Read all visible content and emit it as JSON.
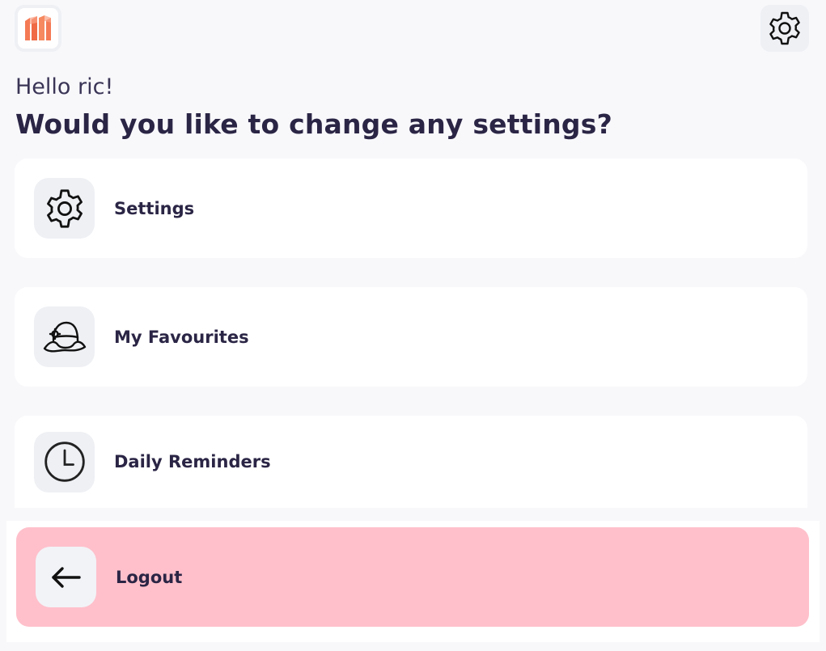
{
  "header": {
    "logo_icon": "app-logo-icon",
    "settings_icon": "gear-icon"
  },
  "greeting": "Hello ric!",
  "heading": "Would you like to change any settings?",
  "menu": [
    {
      "label": "Settings",
      "icon": "gear-icon"
    },
    {
      "label": "My Favourites",
      "icon": "hat-icon"
    },
    {
      "label": "Daily Reminders",
      "icon": "clock-icon"
    }
  ],
  "logout": {
    "label": "Logout",
    "icon": "arrow-left-icon"
  },
  "colors": {
    "background": "#f8f8fb",
    "card": "#ffffff",
    "logout_bg": "#ffc0cb",
    "icon_box": "#eef0f4",
    "text_dark": "#2b2545",
    "logo_accent": "#f47a55"
  }
}
